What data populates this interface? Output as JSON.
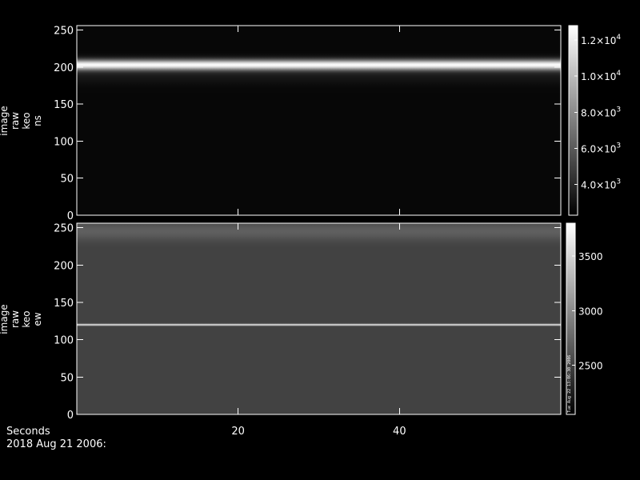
{
  "chart_data": [
    {
      "type": "heatmap",
      "ylabel_lines": [
        "image",
        "raw",
        "keo",
        "ns"
      ],
      "xlim": [
        0,
        60
      ],
      "ylim": [
        0,
        256
      ],
      "y_ticks": [
        0,
        50,
        100,
        150,
        200,
        250
      ],
      "x_ticks": [
        20,
        40
      ],
      "background_level": 2600,
      "bands": [
        {
          "y_center": 203,
          "half_width": 7,
          "peak_level": 12500
        },
        {
          "y_center": 190,
          "half_width": 12,
          "peak_level": 3300
        }
      ],
      "colorbar": {
        "range": [
          2300,
          12800
        ],
        "ticks": [
          {
            "value": 4000,
            "label_mantissa": "4.0×10",
            "label_exp": "3"
          },
          {
            "value": 6000,
            "label_mantissa": "6.0×10",
            "label_exp": "3"
          },
          {
            "value": 8000,
            "label_mantissa": "8.0×10",
            "label_exp": "3"
          },
          {
            "value": 10000,
            "label_mantissa": "1.0×10",
            "label_exp": "4"
          },
          {
            "value": 12000,
            "label_mantissa": "1.2×10",
            "label_exp": "4"
          }
        ]
      }
    },
    {
      "type": "heatmap",
      "ylabel_lines": [
        "image",
        "raw",
        "keo",
        "ew"
      ],
      "xlim": [
        0,
        60
      ],
      "ylim": [
        0,
        256
      ],
      "y_ticks": [
        0,
        50,
        100,
        150,
        200,
        250
      ],
      "x_ticks": [
        20,
        40
      ],
      "background_level": 2500,
      "bands": [
        {
          "y_center": 120,
          "half_width": 1,
          "peak_level": 3700
        },
        {
          "y_center": 245,
          "half_width": 12,
          "peak_level": 2700
        }
      ],
      "colorbar": {
        "range": [
          2050,
          3800
        ],
        "ticks": [
          {
            "value": 2500,
            "label": "2500"
          },
          {
            "value": 3000,
            "label": "3000"
          },
          {
            "value": 3500,
            "label": "3500"
          }
        ]
      },
      "side_stamp": "Tue Aug 22 13:06:30 2006"
    }
  ],
  "xlabel": "Seconds",
  "date_label": "2018 Aug 21 2006:"
}
